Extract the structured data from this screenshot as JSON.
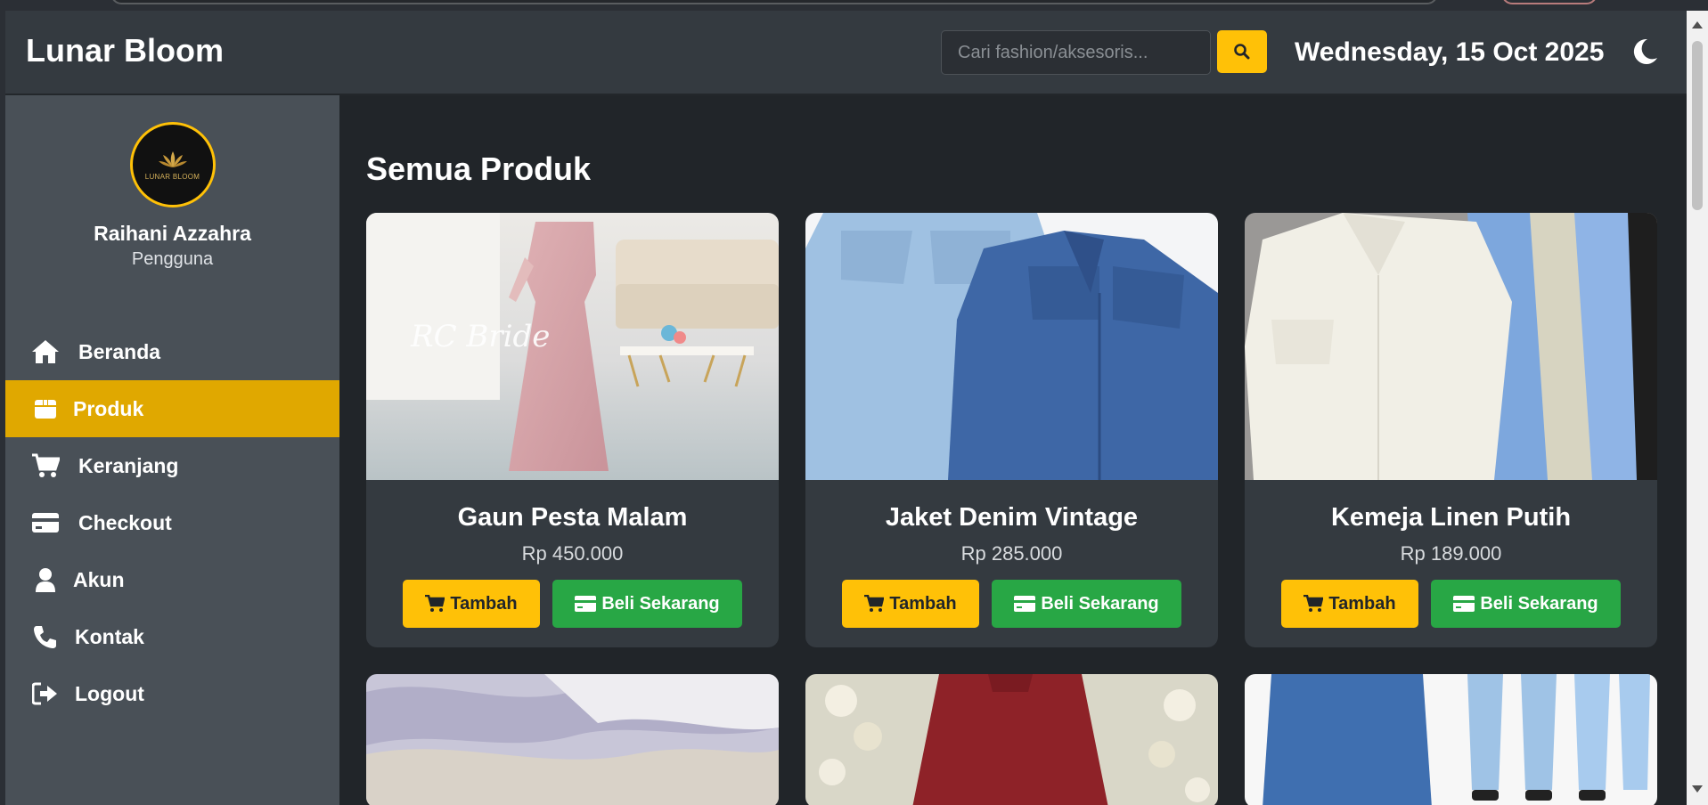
{
  "header": {
    "brand": "Lunar Bloom",
    "search_placeholder": "Cari fashion/aksesoris...",
    "date": "Wednesday, 15 Oct 2025"
  },
  "sidebar": {
    "profile": {
      "name": "Raihani Azzahra",
      "role": "Pengguna",
      "logo_text": "LUNAR BLOOM"
    },
    "items": [
      {
        "label": "Beranda",
        "icon": "home-icon"
      },
      {
        "label": "Produk",
        "icon": "box-icon",
        "active": true
      },
      {
        "label": "Keranjang",
        "icon": "cart-icon"
      },
      {
        "label": "Checkout",
        "icon": "credit-card-icon"
      },
      {
        "label": "Akun",
        "icon": "user-icon"
      },
      {
        "label": "Kontak",
        "icon": "phone-icon"
      },
      {
        "label": "Logout",
        "icon": "logout-icon"
      }
    ]
  },
  "main": {
    "title": "Semua Produk",
    "products": [
      {
        "name": "Gaun Pesta Malam",
        "price": "Rp 450.000",
        "image_caption": "RC Bride"
      },
      {
        "name": "Jaket Denim Vintage",
        "price": "Rp 285.000"
      },
      {
        "name": "Kemeja Linen Putih",
        "price": "Rp 189.000"
      }
    ],
    "add_label": "Tambah",
    "buy_label": "Beli Sekarang"
  },
  "colors": {
    "accent": "#ffc107",
    "active_nav": "#e0a800",
    "buy": "#28a745",
    "header_bg": "#343a40",
    "sidebar_bg": "#495057",
    "main_bg": "#212529"
  }
}
